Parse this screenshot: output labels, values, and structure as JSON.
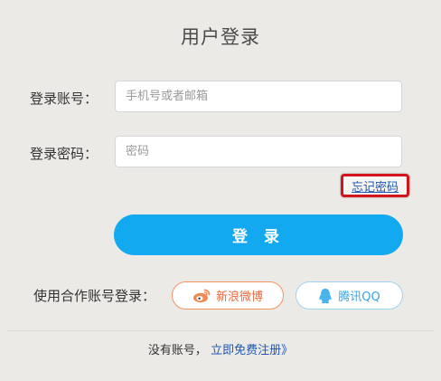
{
  "title": "用户登录",
  "account": {
    "label": "登录账号：",
    "placeholder": "手机号或者邮箱"
  },
  "password": {
    "label": "登录密码：",
    "placeholder": "密码"
  },
  "forgot_password": "忘记密码",
  "login_button": "登 录",
  "social": {
    "label": "使用合作账号登录：",
    "weibo": "新浪微博",
    "qq": "腾讯QQ"
  },
  "footer": {
    "text": "没有账号，",
    "register_link": "立即免费注册》"
  },
  "colors": {
    "background": "#eceae6",
    "primary": "#12a9f0",
    "weibo": "#e8683e",
    "qq": "#3ba3e3",
    "link": "#1f56b3",
    "highlight": "#d4141c"
  }
}
